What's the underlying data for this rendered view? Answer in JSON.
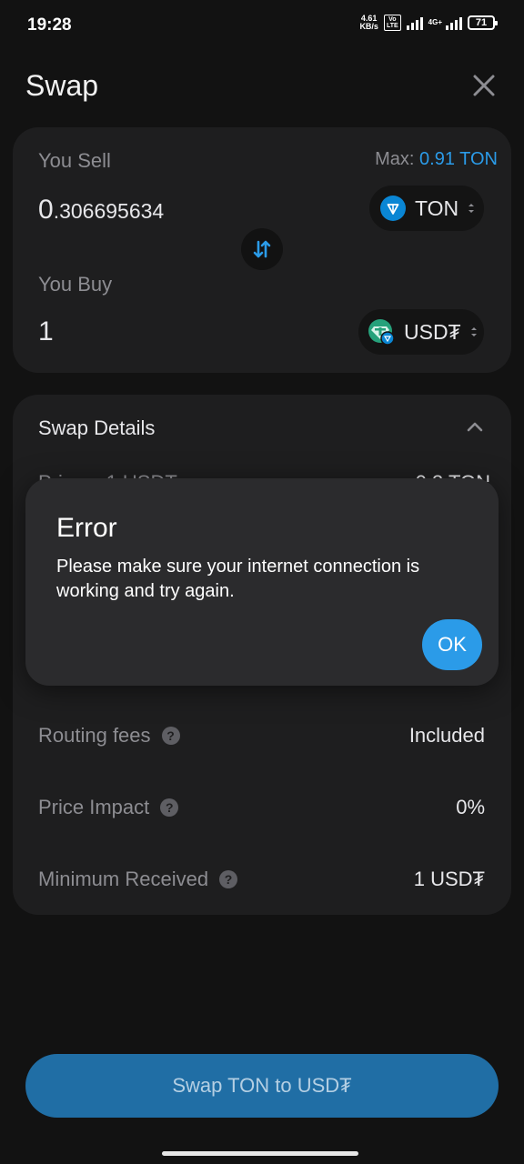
{
  "status_bar": {
    "time": "19:28",
    "net_speed_value": "4.61",
    "net_speed_unit": "KB/s",
    "volte_top": "Vo",
    "volte_bottom": "LTE",
    "network": "4G+",
    "battery": "71"
  },
  "header": {
    "title": "Swap",
    "close_icon": "close-icon"
  },
  "sell": {
    "label": "You Sell",
    "max_label": "Max:",
    "max_value": "0.91 TON",
    "amount_int": "0",
    "amount_frac": ".306695634",
    "token": "TON",
    "token_icon": "ton-icon"
  },
  "buy": {
    "label": "You Buy",
    "amount": "1",
    "token": "USD₮",
    "token_icon": "usdt-icon"
  },
  "details": {
    "title": "Swap Details",
    "partial_left": "Price    1 USD₮",
    "partial_right": "0.3 TON",
    "rows": [
      {
        "label": "Routing fees",
        "value": "Included"
      },
      {
        "label": "Price Impact",
        "value": "0%"
      },
      {
        "label": "Minimum Received",
        "value": "1 USD₮"
      }
    ]
  },
  "dialog": {
    "title": "Error",
    "message": "Please make sure your internet connection is working and try again.",
    "ok_label": "OK"
  },
  "primary_button": {
    "label": "Swap TON to USD₮"
  },
  "colors": {
    "accent": "#2b9be8",
    "background": "#121212",
    "card": "#1e1e1f",
    "dialog": "#2b2b2d",
    "muted_text": "#8d8d92",
    "button_disabled": "#206ea5"
  }
}
